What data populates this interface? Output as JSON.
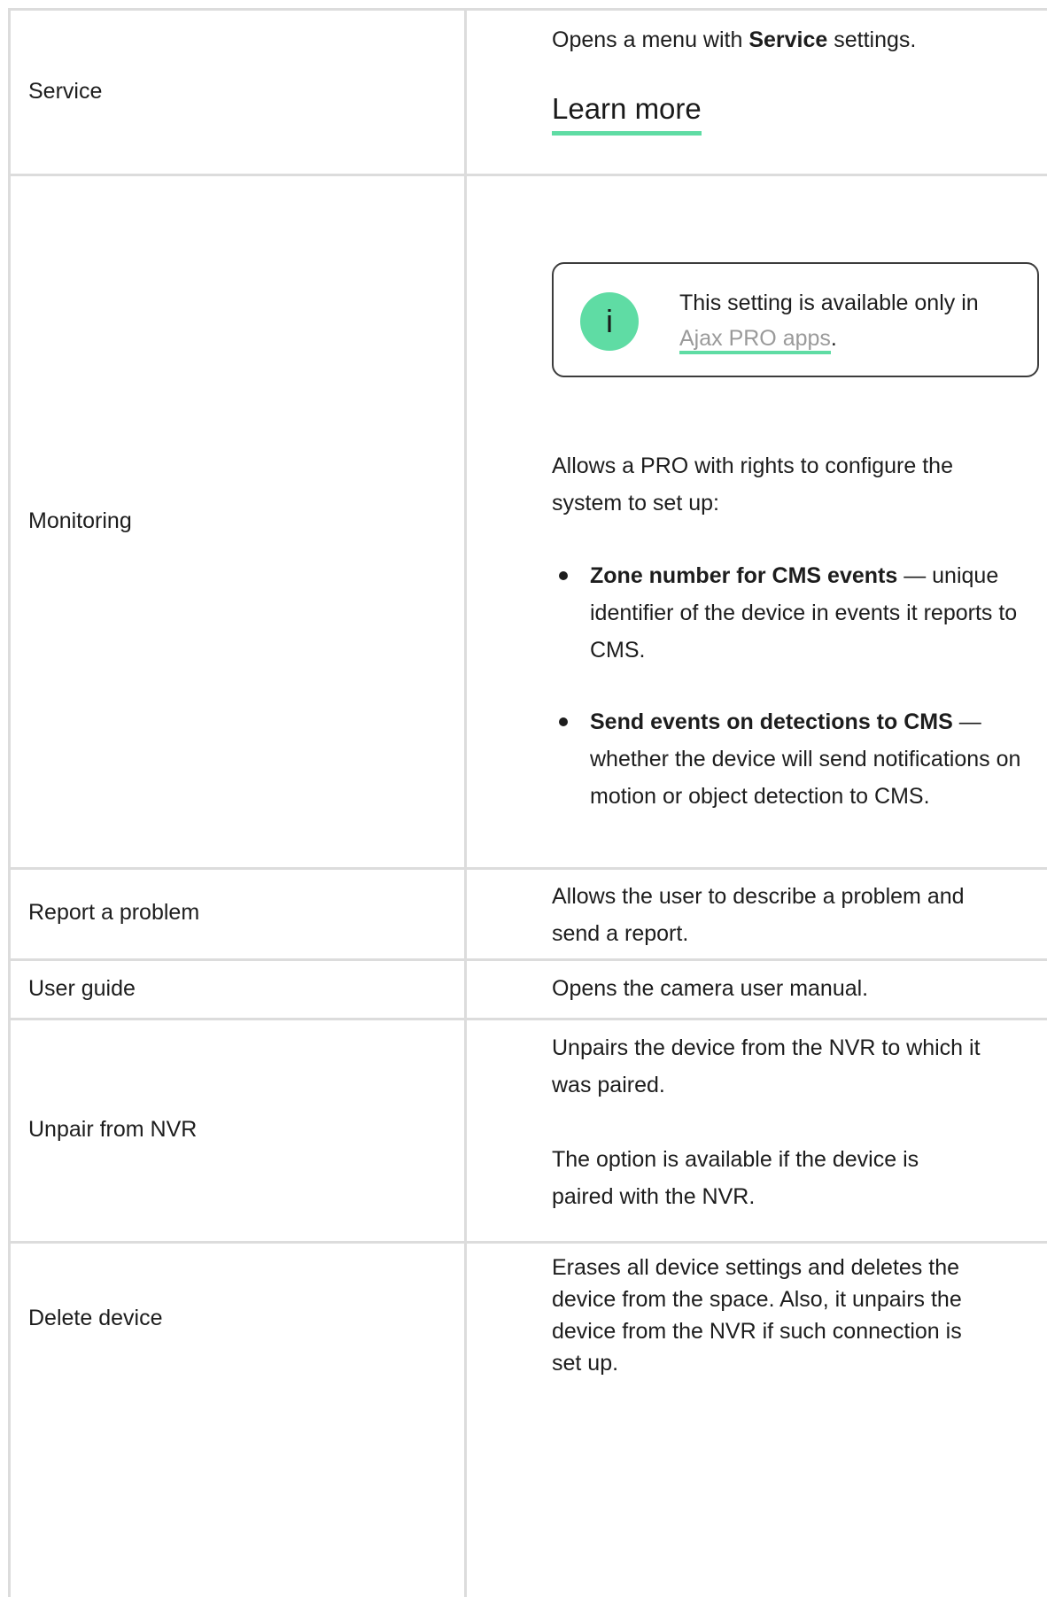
{
  "rows": [
    {
      "label": "Service",
      "desc_prefix": "Opens a menu with ",
      "desc_bold": "Service",
      "desc_suffix": " settings.",
      "link": "Learn more"
    },
    {
      "label": "Monitoring",
      "note": {
        "icon": "info-icon",
        "icon_glyph": "i",
        "text_prefix": "This setting is available only in ",
        "link": "Ajax PRO apps",
        "text_suffix": "."
      },
      "intro": "Allows a PRO with rights to configure the system to set up:",
      "bullets": [
        {
          "bold": "Zone number for CMS events",
          "text": " — unique identifier of the device in events it reports to CMS."
        },
        {
          "bold": "Send events on detections to CMS",
          "text": " — whether the device will send notifications on motion or object detection to CMS."
        }
      ]
    },
    {
      "label": "Report a problem",
      "desc": "Allows the user to describe a problem and send a report."
    },
    {
      "label": "User guide",
      "desc": "Opens the camera user manual."
    },
    {
      "label": "Unpair from NVR",
      "desc_1": "Unpairs the device from the NVR to which it was paired.",
      "desc_2": "The option is available if the device is paired with the NVR."
    },
    {
      "label": "Delete device",
      "desc": "Erases all device settings and deletes the device from the space. Also, it unpairs the device from the NVR if such connection is set up."
    }
  ],
  "colors": {
    "border": "#dcdcdc",
    "accent": "#5fdca4",
    "link_muted": "#9a9a9a",
    "text": "#1d1d1d"
  }
}
